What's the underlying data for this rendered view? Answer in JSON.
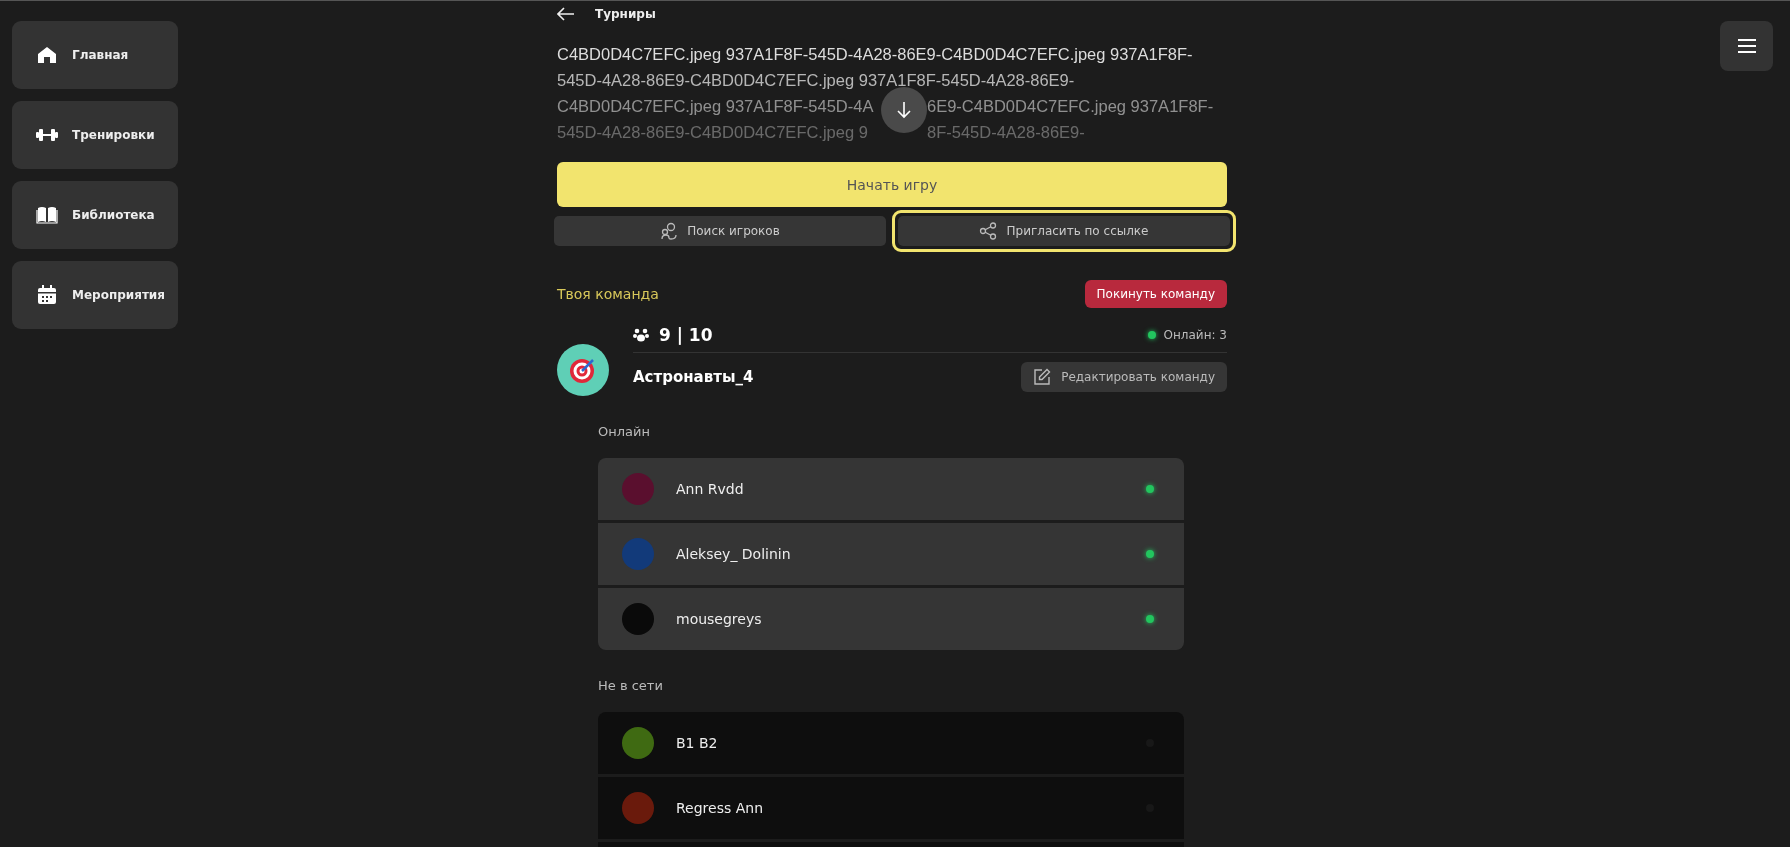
{
  "sidebar": {
    "items": [
      {
        "label": "Главная"
      },
      {
        "label": "Тренировки"
      },
      {
        "label": "Библиотека"
      },
      {
        "label": "Мероприятия"
      }
    ]
  },
  "header": {
    "back_label": "Турниры"
  },
  "description": {
    "lines": [
      [
        "C4BD0D4C7EFC.jpeg 937A1F8F-545D-4A28-86E9-C4BD0D4C7EFC.jpeg 937A1F8F-"
      ],
      [
        "545D-4A28-86E9-C4BD0D4C7EFC.jpeg 937A1F8F-545D-4A28-86E9-"
      ],
      [
        "C4BD0D4C7EFC.jpeg 937A1F8F-545D-4A",
        "6E9-C4BD0D4C7EFC.jpeg 937A1F8F-"
      ],
      [
        "545D-4A28-86E9-C4BD0D4C7EFC.jpeg 9",
        "8F-545D-4A28-86E9-"
      ]
    ]
  },
  "actions": {
    "start": "Начать игру",
    "buttons": [
      {
        "label": "Поиск игроков",
        "focused": false
      },
      {
        "label": "Пригласить по ссылке",
        "focused": true
      }
    ]
  },
  "team": {
    "title": "Твоя команда",
    "leave_button": "Покинуть команду",
    "count": "9 | 10",
    "online": "Онлайн: 3",
    "name": "Астронавты_4",
    "edit_button": "Редактировать команду"
  },
  "groups": [
    {
      "title": "Онлайн",
      "online": true,
      "members": [
        {
          "name": "Ann Rvdd",
          "color": "#5a0f2e"
        },
        {
          "name": "Aleksey_ Dolinin",
          "color": "#123a7a"
        },
        {
          "name": "mousegreys",
          "color": "#0a0a0a"
        }
      ]
    },
    {
      "title": "Не в сети",
      "online": false,
      "members": [
        {
          "name": "B1 B2",
          "color": "#3f6a12"
        },
        {
          "name": "Regress Ann",
          "color": "#6a1a0c"
        }
      ]
    }
  ]
}
